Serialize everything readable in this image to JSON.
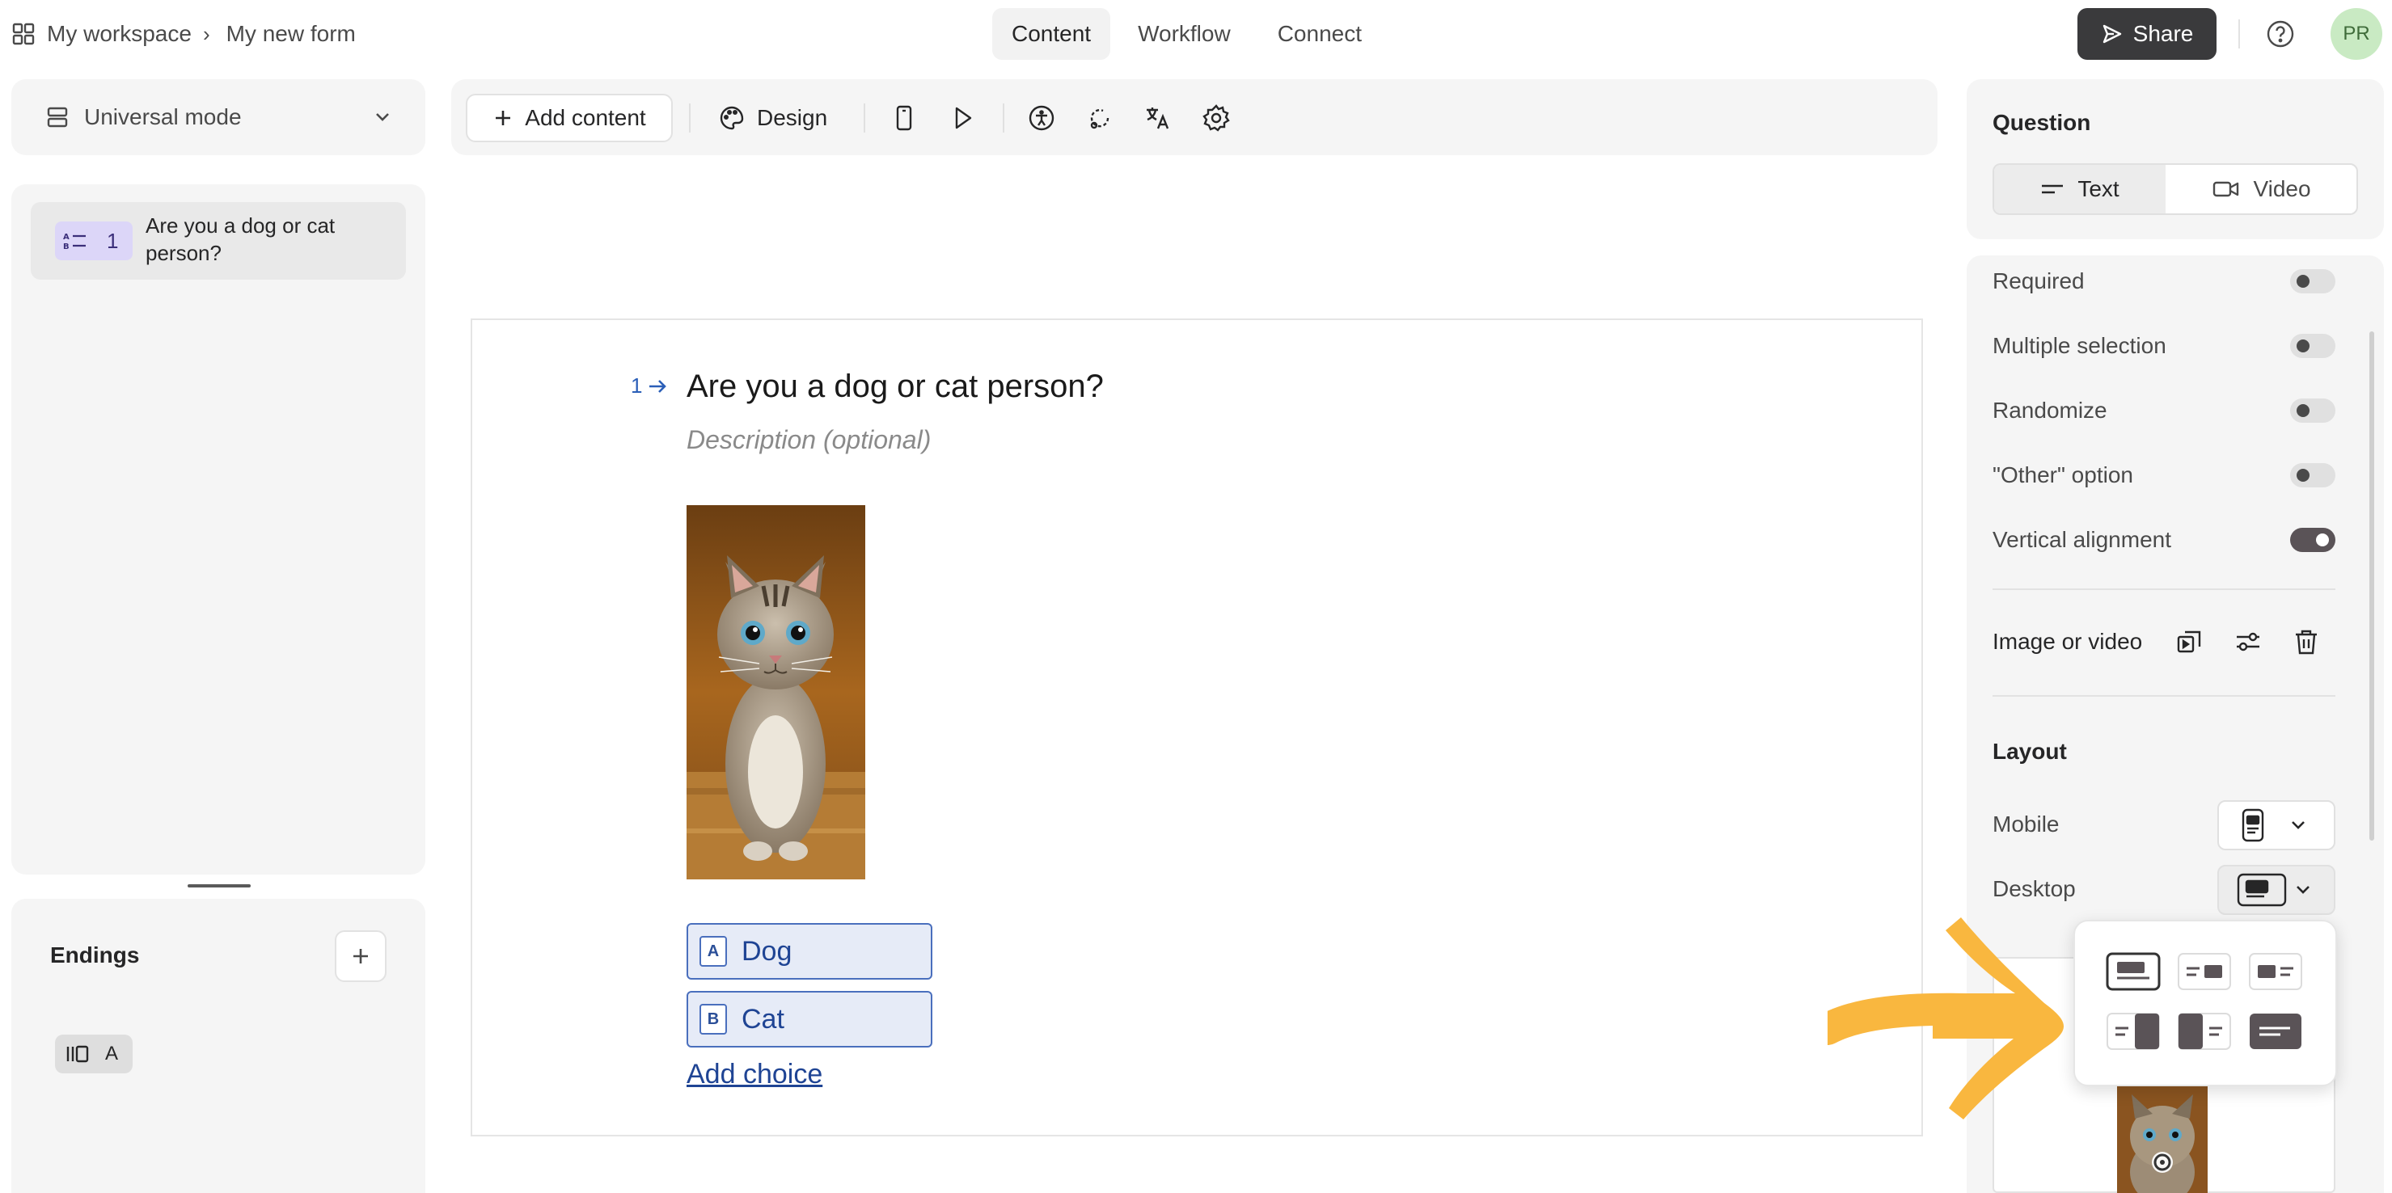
{
  "topbar": {
    "breadcrumb": {
      "workspace": "My workspace",
      "form": "My new form"
    },
    "tabs": [
      {
        "label": "Content",
        "active": true
      },
      {
        "label": "Workflow",
        "active": false
      },
      {
        "label": "Connect",
        "active": false
      }
    ],
    "share_label": "Share",
    "avatar_initials": "PR"
  },
  "sidebar": {
    "mode_label": "Universal mode",
    "questions": [
      {
        "number": "1",
        "title": "Are you a dog or cat person?"
      }
    ],
    "endings_title": "Endings",
    "endings": [
      {
        "label": "A"
      }
    ]
  },
  "toolbar": {
    "add_content_label": "Add content",
    "design_label": "Design"
  },
  "canvas": {
    "question_number": "1",
    "question_title": "Are you a dog or cat person?",
    "description_placeholder": "Description (optional)",
    "choices": [
      {
        "key": "A",
        "label": "Dog"
      },
      {
        "key": "B",
        "label": "Cat"
      }
    ],
    "add_choice_label": "Add choice"
  },
  "right_panel": {
    "question_label": "Question",
    "segment": {
      "text_label": "Text",
      "video_label": "Video",
      "selected": "Text"
    },
    "options": [
      {
        "label": "Required",
        "enabled": false
      },
      {
        "label": "Multiple selection",
        "enabled": false
      },
      {
        "label": "Randomize",
        "enabled": false
      },
      {
        "label": "\"Other\" option",
        "enabled": false
      },
      {
        "label": "Vertical alignment",
        "enabled": true
      }
    ],
    "image_or_video_label": "Image or video",
    "layout_label": "Layout",
    "layout_mobile_label": "Mobile",
    "layout_desktop_label": "Desktop",
    "layout_options_selected_index": 0
  },
  "colors": {
    "accent_choice": "#4a6fbd",
    "share_button": "#3a3a3c",
    "avatar_bg": "#c9eac3",
    "annotation_arrow": "#f9b73f"
  }
}
